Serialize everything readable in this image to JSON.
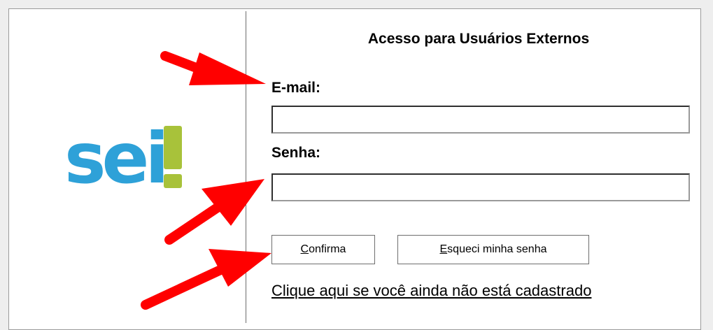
{
  "form": {
    "title": "Acesso para Usuários Externos",
    "email_label": "E-mail:",
    "email_value": "",
    "password_label": "Senha:",
    "password_value": ""
  },
  "logo": {
    "text": "sei",
    "word_color": "#2ea1d8",
    "bang_color": "#a8c23a"
  },
  "buttons": {
    "confirm_access_key": "C",
    "confirm_rest": "onfirma",
    "forgot_access_key": "E",
    "forgot_rest": "squeci minha senha"
  },
  "register_link": "Clique aqui se você ainda não está cadastrado",
  "annotation_color": "#ff0000"
}
